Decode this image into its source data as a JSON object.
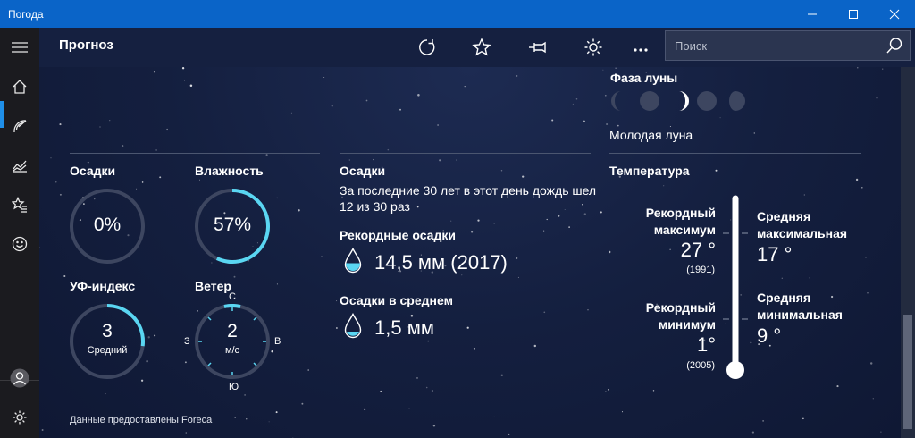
{
  "window": {
    "title": "Погода"
  },
  "command_bar": {
    "title": "Прогноз",
    "search_placeholder": "Поиск"
  },
  "moon": {
    "heading": "Фаза луны",
    "phase_label": "Молодая луна"
  },
  "details": {
    "precip_heading": "Осадки",
    "precip_value": "0%",
    "precip_fraction": 0.0,
    "humidity_heading": "Влажность",
    "humidity_value": "57%",
    "humidity_fraction": 0.57,
    "uv_heading": "УФ-индекс",
    "uv_value": "3",
    "uv_label": "Средний",
    "uv_fraction": 0.27,
    "wind_heading": "Ветер",
    "wind_value": "2",
    "wind_unit": "м/с",
    "wind_n": "С",
    "wind_e": "В",
    "wind_s": "Ю",
    "wind_w": "З"
  },
  "history": {
    "precip_heading": "Осадки",
    "precip_text_1": "За последние 30 лет в этот день дождь шел",
    "precip_text_2": "12 из 30 раз",
    "record_heading": "Рекордные осадки",
    "record_value": "14,5 мм (2017)",
    "avg_heading": "Осадки в среднем",
    "avg_value": "1,5 мм"
  },
  "temperature": {
    "heading": "Температура",
    "record_max_label_1": "Рекордный",
    "record_max_label_2": "максимум",
    "record_max_value": "27 °",
    "record_max_year": "(1991)",
    "record_min_label_1": "Рекордный",
    "record_min_label_2": "минимум",
    "record_min_value": "1°",
    "record_min_year": "(2005)",
    "avg_max_label_1": "Средняя",
    "avg_max_label_2": "максимальная",
    "avg_max_value": "17 °",
    "avg_min_label_1": "Средняя",
    "avg_min_label_2": "минимальная",
    "avg_min_value": "9 °"
  },
  "footer": {
    "credit": "Данные предоставлены Foreca"
  },
  "colors": {
    "accent": "#5ad6f2",
    "titlebar": "#0a64c8",
    "track": "#3d4660"
  }
}
